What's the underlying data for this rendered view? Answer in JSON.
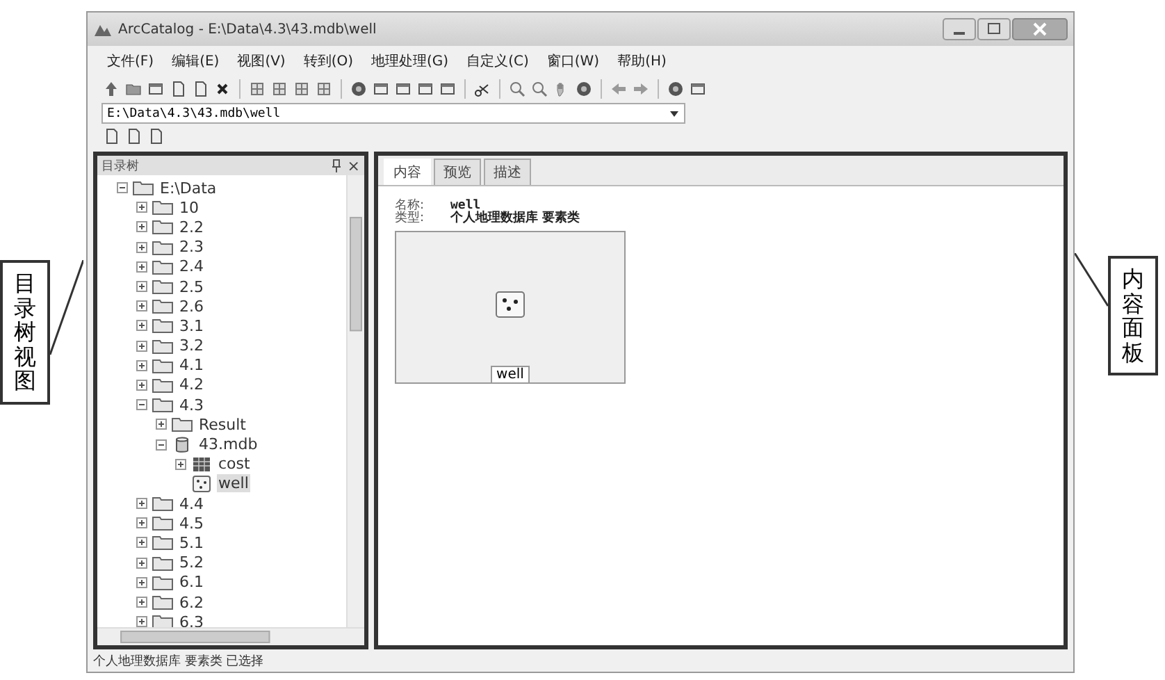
{
  "window": {
    "title": "ArcCatalog - E:\\Data\\4.3\\43.mdb\\well"
  },
  "menu": [
    "文件(F)",
    "编辑(E)",
    "视图(V)",
    "转到(O)",
    "地理处理(G)",
    "自定义(C)",
    "窗口(W)",
    "帮助(H)"
  ],
  "address": {
    "value": "E:\\Data\\4.3\\43.mdb\\well"
  },
  "catalog_tree": {
    "title": "目录树",
    "close": "×",
    "items": [
      {
        "label": "E:\\Data",
        "kind": "folder",
        "expanded": true,
        "selected": false,
        "children": [
          {
            "label": "10",
            "kind": "folder",
            "expanded": false,
            "selected": false
          },
          {
            "label": "2.2",
            "kind": "folder",
            "expanded": false,
            "selected": false
          },
          {
            "label": "2.3",
            "kind": "folder",
            "expanded": false,
            "selected": false
          },
          {
            "label": "2.4",
            "kind": "folder",
            "expanded": false,
            "selected": false
          },
          {
            "label": "2.5",
            "kind": "folder",
            "expanded": false,
            "selected": false
          },
          {
            "label": "2.6",
            "kind": "folder",
            "expanded": false,
            "selected": false
          },
          {
            "label": "3.1",
            "kind": "folder",
            "expanded": false,
            "selected": false
          },
          {
            "label": "3.2",
            "kind": "folder",
            "expanded": false,
            "selected": false
          },
          {
            "label": "4.1",
            "kind": "folder",
            "expanded": false,
            "selected": false
          },
          {
            "label": "4.2",
            "kind": "folder",
            "expanded": false,
            "selected": false
          },
          {
            "label": "4.3",
            "kind": "folder",
            "expanded": true,
            "selected": false,
            "children": [
              {
                "label": "Result",
                "kind": "folder",
                "expanded": false,
                "selected": false
              },
              {
                "label": "43.mdb",
                "kind": "database",
                "expanded": true,
                "selected": false,
                "children": [
                  {
                    "label": "cost",
                    "kind": "table",
                    "expanded": false,
                    "selected": false
                  },
                  {
                    "label": "well",
                    "kind": "points",
                    "selected": true
                  }
                ]
              }
            ]
          },
          {
            "label": "4.4",
            "kind": "folder",
            "expanded": false,
            "selected": false
          },
          {
            "label": "4.5",
            "kind": "folder",
            "expanded": false,
            "selected": false
          },
          {
            "label": "5.1",
            "kind": "folder",
            "expanded": false,
            "selected": false
          },
          {
            "label": "5.2",
            "kind": "folder",
            "expanded": false,
            "selected": false
          },
          {
            "label": "6.1",
            "kind": "folder",
            "expanded": false,
            "selected": false
          },
          {
            "label": "6.2",
            "kind": "folder",
            "expanded": false,
            "selected": false
          },
          {
            "label": "6.3",
            "kind": "folder",
            "expanded": false,
            "selected": false
          }
        ]
      }
    ]
  },
  "tabs": [
    {
      "label": "内容",
      "selected": true
    },
    {
      "label": "预览",
      "selected": false
    },
    {
      "label": "描述",
      "selected": false
    }
  ],
  "contents": {
    "fields": [
      {
        "label": "名称:",
        "value": "well"
      },
      {
        "label": "类型:",
        "value": "个人地理数据库 要素类"
      }
    ],
    "thumbnail_label": "well"
  },
  "status_bar": "个人地理数据库 要素类 已选择",
  "callouts": [
    {
      "label": "目录树视图"
    },
    {
      "label": "内容面板"
    }
  ]
}
